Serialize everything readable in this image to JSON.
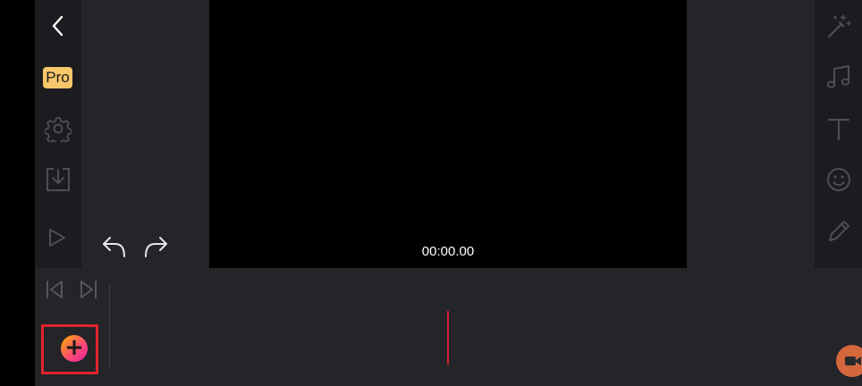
{
  "left_rail": {
    "back_icon": "chevron-left-icon",
    "pro_label": "Pro",
    "settings_icon": "gear-icon",
    "export_icon": "download-icon",
    "play_icon": "play-icon"
  },
  "history": {
    "undo_icon": "undo-icon",
    "redo_icon": "redo-icon"
  },
  "preview": {
    "timecode": "00:00.00"
  },
  "right_rail": {
    "items": [
      "magic-wand-icon",
      "music-note-icon",
      "text-icon",
      "sticker-icon",
      "pencil-icon"
    ]
  },
  "timeline": {
    "jump_start_icon": "skip-to-start-icon",
    "jump_end_icon": "skip-to-end-icon",
    "add_label": "+",
    "camera_icon": "camera-icon"
  },
  "colors": {
    "background": "#242429",
    "rail": "#1c1c20",
    "pro_badge": "#f7c76b",
    "playhead": "#c8202e",
    "highlight": "#e0242c",
    "camera": "#d4673b"
  }
}
